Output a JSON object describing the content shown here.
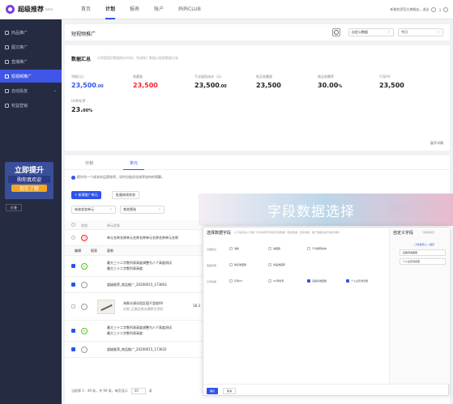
{
  "app": {
    "name": "超级推荐",
    "beta": "beta"
  },
  "nav": [
    "首页",
    "计划",
    "报表",
    "账户",
    "妈妈CLUB"
  ],
  "top_right": {
    "shop": "新都农资官方旗舰店，退出",
    "messages": "3"
  },
  "sidebar": {
    "items": [
      "商品推广",
      "图文推广",
      "直播推广",
      "短视频推广",
      "自动投放",
      "权益营销"
    ],
    "promo": {
      "line1": "立即提升",
      "line2": "购你真欢迎",
      "line3": "现在了解"
    },
    "collapse": "折叠"
  },
  "header": {
    "title": "短视频推广",
    "select1": "自定义数据",
    "select2": "今日"
  },
  "summary": {
    "title": "数据汇总",
    "subtitle": "计划管理页数据统计时间，完成推广数据以报表数据为准",
    "fold": "展开详情",
    "metrics": [
      {
        "label": "消耗(元)",
        "value": "23,500",
        "small": ".00",
        "color": "blue"
      },
      {
        "label": "收藏量",
        "value": "23,500",
        "small": "",
        "color": "red"
      },
      {
        "label": "千次展现成本（元）",
        "value": "23,500",
        "small": ".00",
        "color": ""
      },
      {
        "label": "购买收藏量",
        "value": "23,500",
        "small": "",
        "color": ""
      },
      {
        "label": "商品收藏率",
        "value": "30.00",
        "small": "%",
        "color": ""
      },
      {
        "label": "引导UV",
        "value": "23,500",
        "small": "",
        "color": ""
      },
      {
        "label": "UV转化率",
        "value": "23.",
        "small": "00%",
        "color": ""
      }
    ]
  },
  "tabs": [
    "计划",
    "单元"
  ],
  "notice": "提升你一个成本的运营效率。实时分配优化效率加持的预算。",
  "toolbar": {
    "new_btn": "+ 新建推广单元",
    "batch_btn": "批量修改状态",
    "filter1": "有效状态单元",
    "filter2": "其他筛选",
    "search": "搜索计划"
  },
  "table": {
    "headers": [
      "状态",
      "单元信息"
    ],
    "row0": "单元名称名称单元名称名称单元名称名称单元名称",
    "row1_actions": [
      "编辑",
      "报表",
      "复制"
    ],
    "row2": [
      "最大三十二字数列表高度调整为八个高度测试",
      "最大三十二字数列表高度"
    ],
    "row3": "超级推荐_商品推广_20200615_173603",
    "row4": [
      "淘鲜水源试验区值千里船00",
      "计划 正源品线水源原生涂奶"
    ],
    "row4_num": "18.3",
    "row5": [
      "最大三十二字数列表高度调整为八个高度测试",
      "最大三十二字数列表高度"
    ],
    "row6": "超级推荐_商品推广_20200615_173632"
  },
  "pager": {
    "text": "当前第 1 - 49 条，共 99 条，每页显示",
    "size": "40",
    "unit": "条"
  },
  "overlay": {
    "title": "字段数据选择"
  },
  "dialog": {
    "title": "选择数据字段",
    "subtitle": "以下是您在以下推广方式中所有可用的字段数据（更多数据，更多维度，推广数据请进行指标判断）",
    "groups": [
      {
        "label": "基础信息",
        "options": [
          {
            "t": "消耗",
            "on": false
          },
          {
            "t": "收藏量",
            "on": false
          },
          {
            "t": "千次展现成本",
            "on": false
          }
        ]
      },
      {
        "label": "收藏效果",
        "options": [
          {
            "t": "购买收藏量",
            "on": false
          },
          {
            "t": "商品收藏率",
            "on": false
          }
        ]
      },
      {
        "label": "引导效果",
        "options": [
          {
            "t": "引导UV",
            "on": false
          },
          {
            "t": "UV转化率",
            "on": false
          },
          {
            "t": "直播间收藏量",
            "on": true
          },
          {
            "t": "个人主页浏览量",
            "on": true
          }
        ]
      }
    ],
    "right": {
      "title": "自定义字段",
      "subtitle": "可拖动排序",
      "actions": "◯恢复默认 ▢保存",
      "items": [
        "直播间收藏量",
        "个人主页浏览量"
      ]
    },
    "ok": "确定",
    "cancel": "取消"
  }
}
